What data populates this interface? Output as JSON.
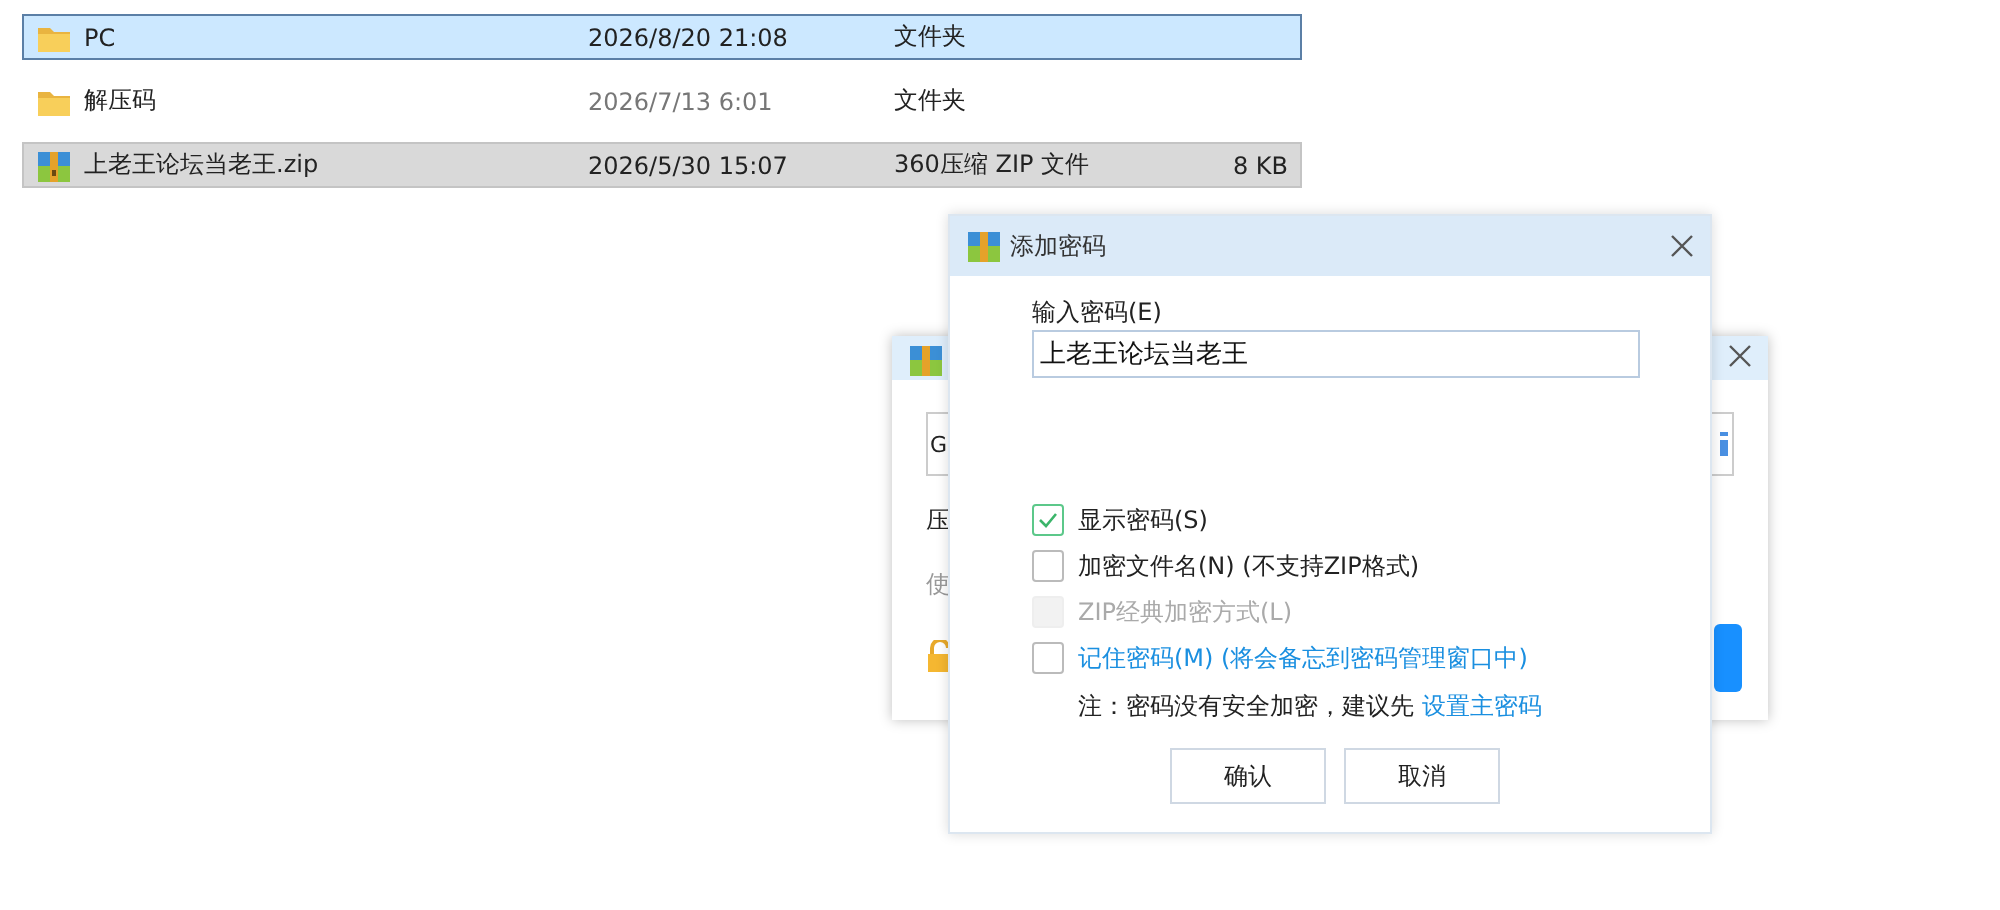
{
  "files": [
    {
      "kind": "folder",
      "name": "PC",
      "date": "2026/8/20 21:08",
      "type": "文件夹",
      "selected": true,
      "hovered": false
    },
    {
      "kind": "folder",
      "name": "解压码",
      "date": "2026/7/13 6:01",
      "type": "文件夹",
      "selected": false,
      "hovered": false
    },
    {
      "kind": "archive",
      "name": "上老王论坛当老王.zip",
      "date": "2026/5/30 15:07",
      "type": "360压缩 ZIP 文件",
      "size": "8 KB",
      "selected": false,
      "hovered": true
    }
  ],
  "back_dialog": {
    "field_value": "G",
    "label": "压",
    "hint": "使"
  },
  "dialog": {
    "title": "添加密码",
    "password_label": "输入密码(E)",
    "password": "上老王论坛当老王",
    "options": [
      {
        "kind": "plain",
        "label": "显示密码(S)",
        "checked": true,
        "disabled": false
      },
      {
        "kind": "plain",
        "label": "加密文件名(N) (不支持ZIP格式)",
        "checked": false,
        "disabled": false
      },
      {
        "kind": "plain",
        "label": "ZIP经典加密方式(L)",
        "checked": false,
        "disabled": true
      },
      {
        "kind": "link",
        "label": "记住密码(M) (将会备忘到密码管理窗口中)",
        "checked": false,
        "disabled": false
      }
    ],
    "note": "注：密码没有安全加密，建议先",
    "note_link": "设置主密码",
    "buttons": [
      "确认",
      "取消"
    ]
  }
}
